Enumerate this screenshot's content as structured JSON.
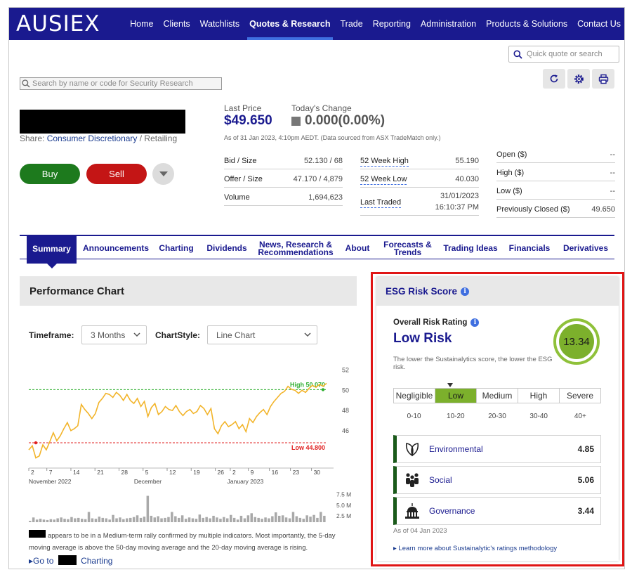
{
  "nav": {
    "logo": "AUSIEX",
    "items": [
      "Home",
      "Clients",
      "Watchlists",
      "Quotes & Research",
      "Trade",
      "Reporting",
      "Administration",
      "Products & Solutions",
      "Contact Us"
    ],
    "active": "Quotes & Research"
  },
  "quick_quote": {
    "placeholder": "Quick quote or search"
  },
  "security_search": {
    "placeholder": "Search by name or code for Security Research"
  },
  "security": {
    "share_label": "Share:",
    "sector": "Consumer Discretionary",
    "industry": "/ Retailing"
  },
  "actions": {
    "buy": "Buy",
    "sell": "Sell"
  },
  "quote": {
    "last_price_label": "Last Price",
    "last_price": "$49.650",
    "change_label": "Today's Change",
    "change": "0.000(0.00%)",
    "as_of": "As of 31 Jan 2023, 4:10pm AEDT. (Data sourced from ASX TradeMatch only.)",
    "col1": [
      {
        "k": "Bid / Size",
        "v": "52.130 / 68"
      },
      {
        "k": "Offer / Size",
        "v": "47.170 / 4,879"
      },
      {
        "k": "Volume",
        "v": "1,694,623"
      }
    ],
    "col2": [
      {
        "k": "52 Week High",
        "v": "55.190"
      },
      {
        "k": "52 Week Low",
        "v": "40.030"
      },
      {
        "k": "Last Traded",
        "v": "31/01/2023",
        "v2": "16:10:37 PM"
      }
    ],
    "col3": [
      {
        "k": "Open ($)",
        "v": "--"
      },
      {
        "k": "High ($)",
        "v": "--"
      },
      {
        "k": "Low ($)",
        "v": "--"
      },
      {
        "k": "Previously Closed ($)",
        "v": "49.650"
      }
    ]
  },
  "tabs": [
    {
      "label": "Summary"
    },
    {
      "label": "Announcements"
    },
    {
      "label": "Charting"
    },
    {
      "label": "Dividends"
    },
    {
      "label1": "News, Research &",
      "label2": "Recommendations"
    },
    {
      "label": "About"
    },
    {
      "label1": "Forecasts &",
      "label2": "Trends"
    },
    {
      "label": "Trading Ideas"
    },
    {
      "label": "Financials"
    },
    {
      "label": "Derivatives"
    }
  ],
  "perf": {
    "title": "Performance Chart",
    "timeframe_label": "Timeframe:",
    "timeframe_value": "3 Months",
    "chartstyle_label": "ChartStyle:",
    "chartstyle_value": "Line Chart",
    "blurb": "appears to be in a Medium-term rally confirmed by multiple indicators. Most importantly, the 5-day moving average is above the 50-day moving average and the 20-day moving average is rising.",
    "goto_prefix": "▸Go to",
    "goto_suffix": "Charting"
  },
  "chart_data": {
    "type": "line",
    "price_series": [
      44.1,
      44.5,
      43.3,
      43.5,
      44.6,
      44.1,
      44.9,
      45.8,
      45.0,
      45.5,
      46.2,
      46.8,
      46.0,
      46.2,
      46.5,
      48.6,
      48.1,
      47.7,
      47.2,
      47.7,
      48.8,
      49.2,
      49.7,
      49.6,
      49.3,
      49.8,
      49.5,
      49.0,
      49.6,
      49.0,
      48.7,
      49.2,
      48.4,
      48.9,
      47.4,
      48.3,
      48.7,
      47.6,
      47.9,
      48.4,
      48.1,
      48.0,
      48.5,
      47.9,
      47.5,
      47.9,
      48.1,
      47.7,
      47.9,
      48.5,
      48.2,
      47.6,
      48.2,
      46.2,
      45.7,
      46.5,
      46.9,
      46.4,
      46.6,
      46.9,
      46.2,
      46.6,
      45.9,
      47.2,
      46.8,
      47.4,
      47.8,
      48.1,
      47.6,
      48.4,
      48.9,
      49.3,
      49.7,
      49.9,
      50.4,
      50.1,
      50.0,
      49.7,
      50.0,
      49.8,
      50.2,
      50.5,
      50.3,
      50.6,
      50.4,
      50.7
    ],
    "high": {
      "label": "High 50.070",
      "value": 50.07
    },
    "low": {
      "label": "Low 44.800",
      "value": 44.8
    },
    "ylim": [
      43.2,
      52.4
    ],
    "y_ticks": [
      "52",
      "50",
      "48",
      "46"
    ],
    "y_tick_values": [
      52,
      50,
      48,
      46
    ],
    "x_ticks": [
      "2",
      "7",
      "14",
      "21",
      "28",
      "5",
      "12",
      "19",
      "26",
      "2",
      "9",
      "16",
      "23",
      "30"
    ],
    "x_tick_pos": [
      0,
      6,
      14,
      22,
      30,
      38,
      46,
      54,
      62,
      67,
      73,
      80,
      87,
      94
    ],
    "months": [
      "November 2022",
      "December",
      "January 2023"
    ],
    "month_pos": [
      0,
      35,
      66
    ],
    "volume_ticks": [
      "7.5 M",
      "5.0 M",
      "2.5 M"
    ],
    "volume_tick_values": [
      7.5,
      5.0,
      2.5
    ],
    "volume_max": 8.6,
    "volume": [
      1.3,
      2.1,
      1.6,
      1.8,
      1.6,
      1.5,
      1.7,
      1.6,
      1.9,
      2.1,
      1.8,
      1.7,
      2.2,
      1.9,
      2.0,
      1.8,
      1.7,
      3.4,
      1.9,
      1.8,
      2.3,
      2.0,
      1.9,
      1.6,
      2.7,
      1.9,
      2.1,
      1.7,
      1.9,
      2.0,
      2.2,
      2.6,
      2.0,
      2.3,
      7.2,
      2.5,
      2.1,
      2.4,
      1.9,
      2.0,
      2.2,
      3.4,
      2.4,
      2.0,
      2.6,
      1.8,
      2.1,
      1.9,
      1.8,
      2.8,
      2.0,
      2.2,
      1.9,
      2.5,
      2.1,
      1.8,
      2.2,
      1.9,
      2.7,
      2.0,
      1.6,
      2.5,
      1.9,
      2.6,
      3.1,
      2.2,
      2.0,
      1.8,
      2.1,
      1.9,
      2.4,
      3.3,
      2.5,
      2.6,
      2.1,
      1.9,
      3.4,
      2.4,
      2.0,
      1.8,
      2.6,
      2.3,
      2.7,
      2.0,
      3.4,
      2.5
    ]
  },
  "esg": {
    "title": "ESG Risk Score",
    "overall_label": "Overall Risk Rating",
    "overall_value": "Low Risk",
    "note": "The lower the Sustainalytics score, the lower the ESG risk.",
    "score": "13.34",
    "bands": [
      "Negligible",
      "Low",
      "Medium",
      "High",
      "Severe"
    ],
    "active_band": 1,
    "ranges": [
      "0-10",
      "10-20",
      "20-30",
      "30-40",
      "40+"
    ],
    "pillars": [
      {
        "name": "Environmental",
        "value": "4.85",
        "icon": "leaf-icon"
      },
      {
        "name": "Social",
        "value": "5.06",
        "icon": "people-icon"
      },
      {
        "name": "Governance",
        "value": "3.44",
        "icon": "capitol-icon"
      }
    ],
    "as_of": "As of 04 Jan 2023",
    "learn_more": "▸ Learn more about Sustainalytic's ratings methodology"
  },
  "colors": {
    "brand": "#1a1a8f",
    "buy": "#1d7a1d",
    "sell": "#c41515",
    "line": "#f2b42a",
    "high": "#2fae2f",
    "low": "#e02020",
    "esg_green": "#7cb02c",
    "highlight_border": "#e01515"
  }
}
